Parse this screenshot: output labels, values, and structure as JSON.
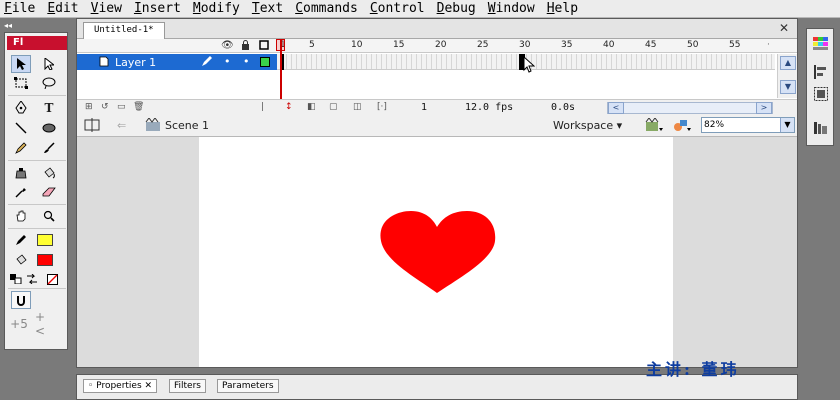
{
  "menubar": {
    "items": [
      {
        "mn": "F",
        "rest": "ile"
      },
      {
        "mn": "E",
        "rest": "dit"
      },
      {
        "mn": "V",
        "rest": "iew"
      },
      {
        "mn": "I",
        "rest": "nsert"
      },
      {
        "mn": "M",
        "rest": "odify"
      },
      {
        "mn": "T",
        "rest": "ext"
      },
      {
        "mn": "C",
        "rest": "ommands"
      },
      {
        "mn": "C",
        "rest": "ontrol"
      },
      {
        "mn": "D",
        "rest": "ebug"
      },
      {
        "mn": "W",
        "rest": "indow"
      },
      {
        "mn": "H",
        "rest": "elp"
      }
    ]
  },
  "tools": {
    "logo": "Fl",
    "grip": "◂◂",
    "stroke_color": "#ffff33",
    "fill_color": "#ff0000"
  },
  "document": {
    "tab_title": "Untitled-1*",
    "close_glyph": "✕"
  },
  "timeline": {
    "frame_numbers": [
      "1",
      "5",
      "10",
      "15",
      "20",
      "25",
      "30",
      "35",
      "40",
      "45",
      "50",
      "55"
    ],
    "layer_name": "Layer 1",
    "current_frame": "1",
    "fps": "12.0 fps",
    "elapsed": "0.0s"
  },
  "editbar": {
    "scene": "Scene 1",
    "workspace": "Workspace",
    "zoom": "82%"
  },
  "stage": {
    "heart_color": "#ff0000"
  },
  "properties": {
    "tabs": [
      "Properties",
      "Filters",
      "Parameters"
    ]
  },
  "watermark": "主讲: 董玮"
}
